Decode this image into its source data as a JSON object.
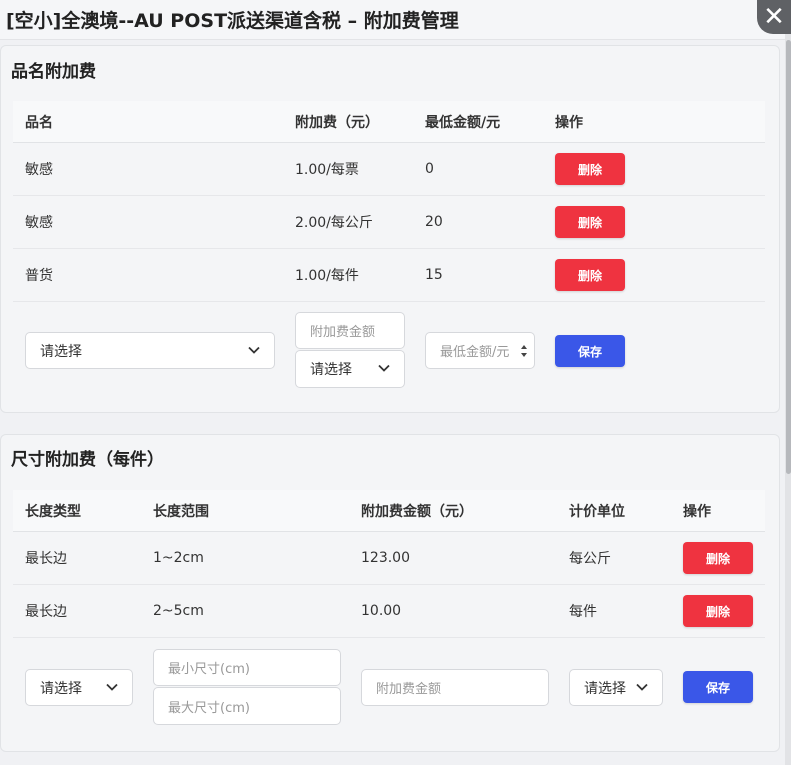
{
  "window": {
    "title": "[空小]全澳境--AU POST派送渠道含税 – 附加费管理",
    "close_glyph": "✕"
  },
  "product_surcharge": {
    "title": "品名附加费",
    "columns": [
      "品名",
      "附加费（元）",
      "最低金额/元",
      "操作"
    ],
    "rows": [
      {
        "name": "敏感",
        "fee": "1.00/每票",
        "min": "0",
        "action": "删除"
      },
      {
        "name": "敏感",
        "fee": "2.00/每公斤",
        "min": "20",
        "action": "删除"
      },
      {
        "name": "普货",
        "fee": "1.00/每件",
        "min": "15",
        "action": "删除"
      }
    ],
    "form": {
      "name_select": "请选择",
      "fee_placeholder": "附加费金额",
      "unit_select": "请选择",
      "min_placeholder": "最低金额/元",
      "save_label": "保存"
    }
  },
  "size_surcharge": {
    "title": "尺寸附加费（每件）",
    "columns": [
      "长度类型",
      "长度范围",
      "附加费金额（元）",
      "计价单位",
      "操作"
    ],
    "rows": [
      {
        "type": "最长边",
        "range": "1~2cm",
        "fee": "123.00",
        "unit": "每公斤",
        "action": "删除"
      },
      {
        "type": "最长边",
        "range": "2~5cm",
        "fee": "10.00",
        "unit": "每件",
        "action": "删除"
      }
    ],
    "form": {
      "type_select": "请选择",
      "min_placeholder": "最小尺寸(cm)",
      "max_placeholder": "最大尺寸(cm)",
      "fee_placeholder": "附加费金额",
      "unit_select": "请选择",
      "save_label": "保存"
    }
  },
  "colors": {
    "delete": "#ef3340",
    "save": "#3a57e8"
  }
}
